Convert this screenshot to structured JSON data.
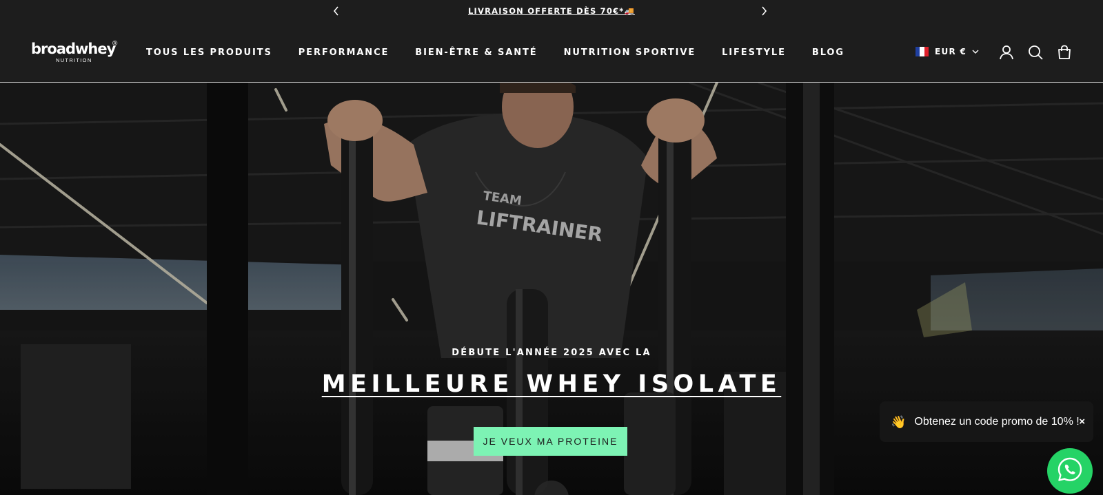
{
  "announcement": {
    "message": "LIVRAISON OFFERTE DÈS 70€*🚚",
    "prev_icon": "chevron-left-icon",
    "next_icon": "chevron-right-icon"
  },
  "header": {
    "logo": {
      "brand": "broadwhey",
      "sub": "NUTRITION",
      "mark": "®"
    },
    "nav": [
      {
        "label": "TOUS LES PRODUITS"
      },
      {
        "label": "PERFORMANCE"
      },
      {
        "label": "BIEN-ÊTRE & SANTÉ"
      },
      {
        "label": "NUTRITION SPORTIVE"
      },
      {
        "label": "LIFESTYLE"
      },
      {
        "label": "BLOG"
      }
    ],
    "currency": {
      "label": "EUR €",
      "flag_colors": [
        "#1f3fa0",
        "#ffffff",
        "#e0202b"
      ]
    },
    "icons": [
      "account-icon",
      "search-icon",
      "cart-icon"
    ]
  },
  "hero": {
    "pre_title": "DÉBUTE L'ANNÉE 2025 AVEC LA",
    "title": "MEILLEURE WHEY ISOLATE",
    "cta_label": "JE VEUX MA PROTEINE",
    "cta_color": "#7df3b4",
    "shirt_text_1": "TEAM",
    "shirt_text_2": "LIFTRAINER"
  },
  "promo": {
    "emoji": "👋",
    "text": "Obtenez un code promo de 10% !",
    "close": "×"
  },
  "whatsapp": {
    "color": "#25d366",
    "icon": "whatsapp-icon"
  }
}
